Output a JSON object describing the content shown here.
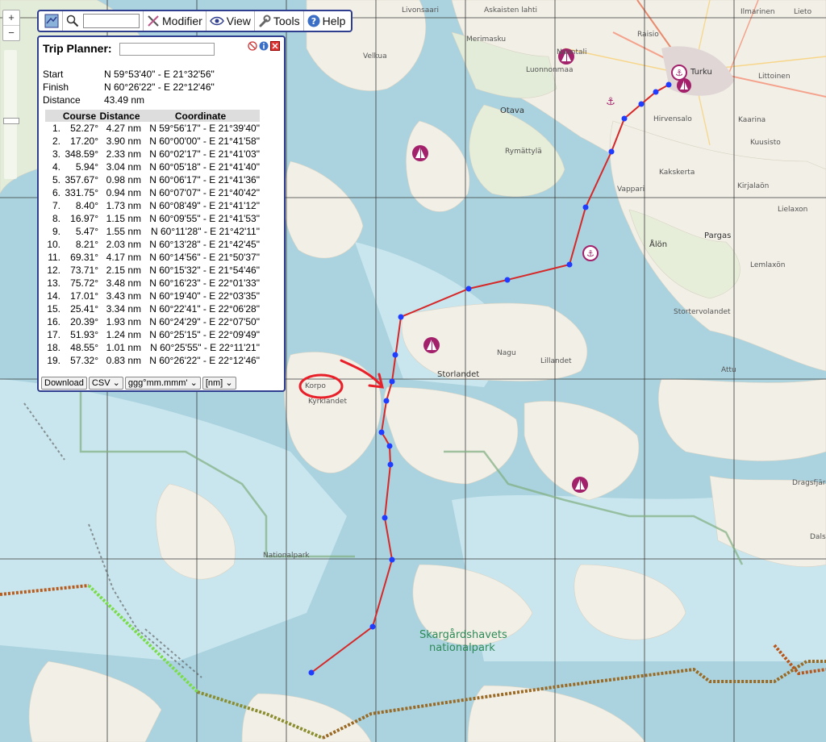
{
  "map": {
    "places": [
      "Livonsaari",
      "Askaisten lahti",
      "Ilmarinen",
      "Lieto",
      "Raisio",
      "Velkua",
      "Merimasku",
      "Naantali",
      "Luonnonmaa",
      "Turku",
      "Littoinen",
      "Otava",
      "Hirvensalo",
      "Kaarina",
      "Kuusisto",
      "Rymättylä",
      "Kakskerta",
      "Kirjalaön",
      "Vappari",
      "Lielaxon",
      "Pargas",
      "Ålön",
      "Lemlaxön",
      "Stortervolandet",
      "Nagu",
      "Lillandet",
      "Storlandet",
      "Attu",
      "Korpo",
      "Kyrklandet",
      "Dragsfjärd",
      "Dals",
      "Nationalpark",
      "Skargårdshavets",
      "nationalpark"
    ]
  },
  "toolbar": {
    "search_placeholder": "",
    "modifier": "Modifier",
    "view": "View",
    "tools": "Tools",
    "help": "Help"
  },
  "zoom": {
    "plus": "+",
    "minus": "−"
  },
  "trip": {
    "title": "Trip Planner:",
    "name_value": "",
    "start_label": "Start",
    "start": "N 59°53'40\" - E 21°32'56\"",
    "finish_label": "Finish",
    "finish": "N 60°26'22\" - E 22°12'46\"",
    "distance_label": "Distance",
    "distance": "43.49 nm",
    "headers": [
      "",
      "Course",
      "Distance",
      "Coordinate"
    ],
    "legs": [
      [
        "1.",
        "52.27°",
        "4.27 nm",
        "N 59°56'17\" - E 21°39'40\""
      ],
      [
        "2.",
        "17.20°",
        "3.90 nm",
        "N 60°00'00\" - E 21°41'58\""
      ],
      [
        "3.",
        "348.59°",
        "2.33 nm",
        "N 60°02'17\" - E 21°41'03\""
      ],
      [
        "4.",
        "5.94°",
        "3.04 nm",
        "N 60°05'18\" - E 21°41'40\""
      ],
      [
        "5.",
        "357.67°",
        "0.98 nm",
        "N 60°06'17\" - E 21°41'36\""
      ],
      [
        "6.",
        "331.75°",
        "0.94 nm",
        "N 60°07'07\" - E 21°40'42\""
      ],
      [
        "7.",
        "8.40°",
        "1.73 nm",
        "N 60°08'49\" - E 21°41'12\""
      ],
      [
        "8.",
        "16.97°",
        "1.15 nm",
        "N 60°09'55\" - E 21°41'53\""
      ],
      [
        "9.",
        "5.47°",
        "1.55 nm",
        "N 60°11'28\" - E 21°42'11\""
      ],
      [
        "10.",
        "8.21°",
        "2.03 nm",
        "N 60°13'28\" - E 21°42'45\""
      ],
      [
        "11.",
        "69.31°",
        "4.17 nm",
        "N 60°14'56\" - E 21°50'37\""
      ],
      [
        "12.",
        "73.71°",
        "2.15 nm",
        "N 60°15'32\" - E 21°54'46\""
      ],
      [
        "13.",
        "75.72°",
        "3.48 nm",
        "N 60°16'23\" - E 22°01'33\""
      ],
      [
        "14.",
        "17.01°",
        "3.43 nm",
        "N 60°19'40\" - E 22°03'35\""
      ],
      [
        "15.",
        "25.41°",
        "3.34 nm",
        "N 60°22'41\" - E 22°06'28\""
      ],
      [
        "16.",
        "20.39°",
        "1.93 nm",
        "N 60°24'29\" - E 22°07'50\""
      ],
      [
        "17.",
        "51.93°",
        "1.24 nm",
        "N 60°25'15\" - E 22°09'49\""
      ],
      [
        "18.",
        "48.55°",
        "1.01 nm",
        "N 60°25'55\" - E 22°11'21\""
      ],
      [
        "19.",
        "57.32°",
        "0.83 nm",
        "N 60°26'22\" - E 22°12'46\""
      ]
    ],
    "download": "Download",
    "format": "CSV",
    "coord_format": "ggg°mm.mmm'",
    "unit": "[nm]"
  },
  "colors": {
    "route": "#d62828",
    "waypoint": "#1f3cff",
    "frame": "#2f3e8e",
    "annotation": "#e8202a"
  }
}
